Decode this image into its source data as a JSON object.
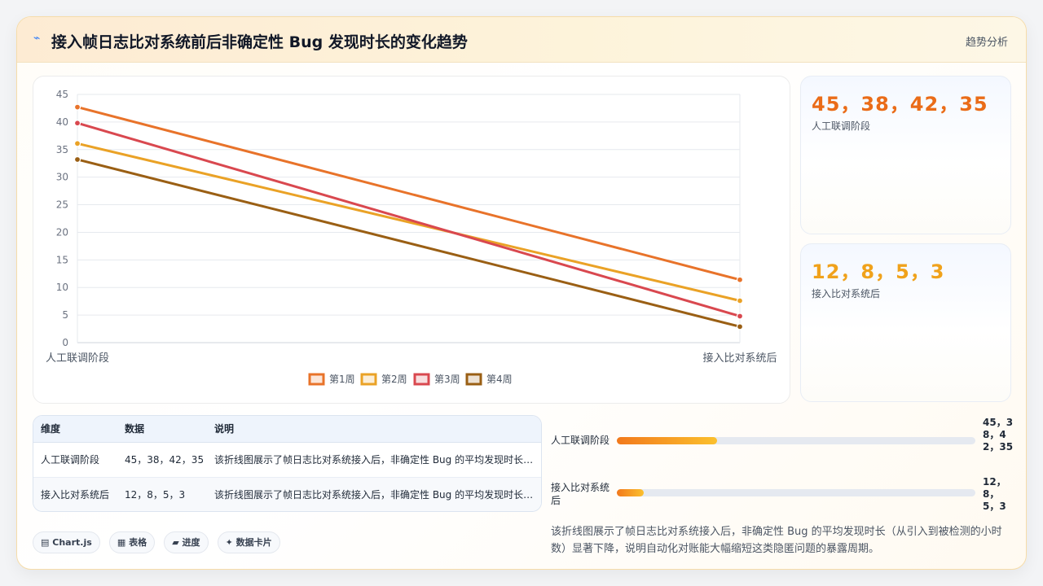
{
  "header": {
    "title": "接入帧日志比对系统前后非确定性 Bug 发现时长的变化趋势",
    "link": "趋势分析",
    "icon": "lightning-icon"
  },
  "chart_data": {
    "type": "line",
    "categories": [
      "人工联调阶段",
      "接入比对系统后"
    ],
    "series": [
      {
        "name": "第1周",
        "values": [
          42.7,
          11.4
        ],
        "color": "#e8732a"
      },
      {
        "name": "第2周",
        "values": [
          36.1,
          7.6
        ],
        "color": "#eaa226"
      },
      {
        "name": "第3周",
        "values": [
          39.8,
          4.8
        ],
        "color": "#d9484f"
      },
      {
        "name": "第4周",
        "values": [
          33.2,
          2.9
        ],
        "color": "#9a5f14"
      }
    ],
    "ylim": [
      0,
      45
    ],
    "yticks": [
      0,
      5,
      10,
      15,
      20,
      25,
      30,
      35,
      40,
      45
    ],
    "grid": true,
    "legend": "bottom"
  },
  "stats": [
    {
      "value": "45，38，42，35",
      "label": "人工联调阶段"
    },
    {
      "value": "12，8，5，3",
      "label": "接入比对系统后"
    }
  ],
  "table": {
    "headers": [
      "维度",
      "数据",
      "说明"
    ],
    "rows": [
      [
        "人工联调阶段",
        "45，38，42，35",
        "该折线图展示了帧日志比对系统接入后，非确定性 Bug 的平均发现时长（从引入到被检测的小时数）显著下降，说明自动化对账能大幅缩短这类隐匿问题的暴露周期。"
      ],
      [
        "接入比对系统后",
        "12，8，5，3",
        "该折线图展示了帧日志比对系统接入后，非确定性 Bug 的平均发现时长（从引入到被检测的小时数）显著下降，说明自动化对账能大幅缩短这类隐匿问题的暴露周期。"
      ]
    ]
  },
  "progress": [
    {
      "label": "人工联调阶段",
      "value": "45，38，42，35",
      "fraction": 0.28
    },
    {
      "label": "接入比对系统后",
      "value": "12，8，5，3",
      "fraction": 0.075
    }
  ],
  "description": "该折线图展示了帧日志比对系统接入后，非确定性 Bug 的平均发现时长（从引入到被检测的小时数）显著下降，说明自动化对账能大幅缩短这类隐匿问题的暴露周期。",
  "chips": [
    {
      "icon": "▤",
      "label": "Chart.js"
    },
    {
      "icon": "▦",
      "label": "表格"
    },
    {
      "icon": "▰",
      "label": "进度"
    },
    {
      "icon": "✦",
      "label": "数据卡片"
    }
  ]
}
